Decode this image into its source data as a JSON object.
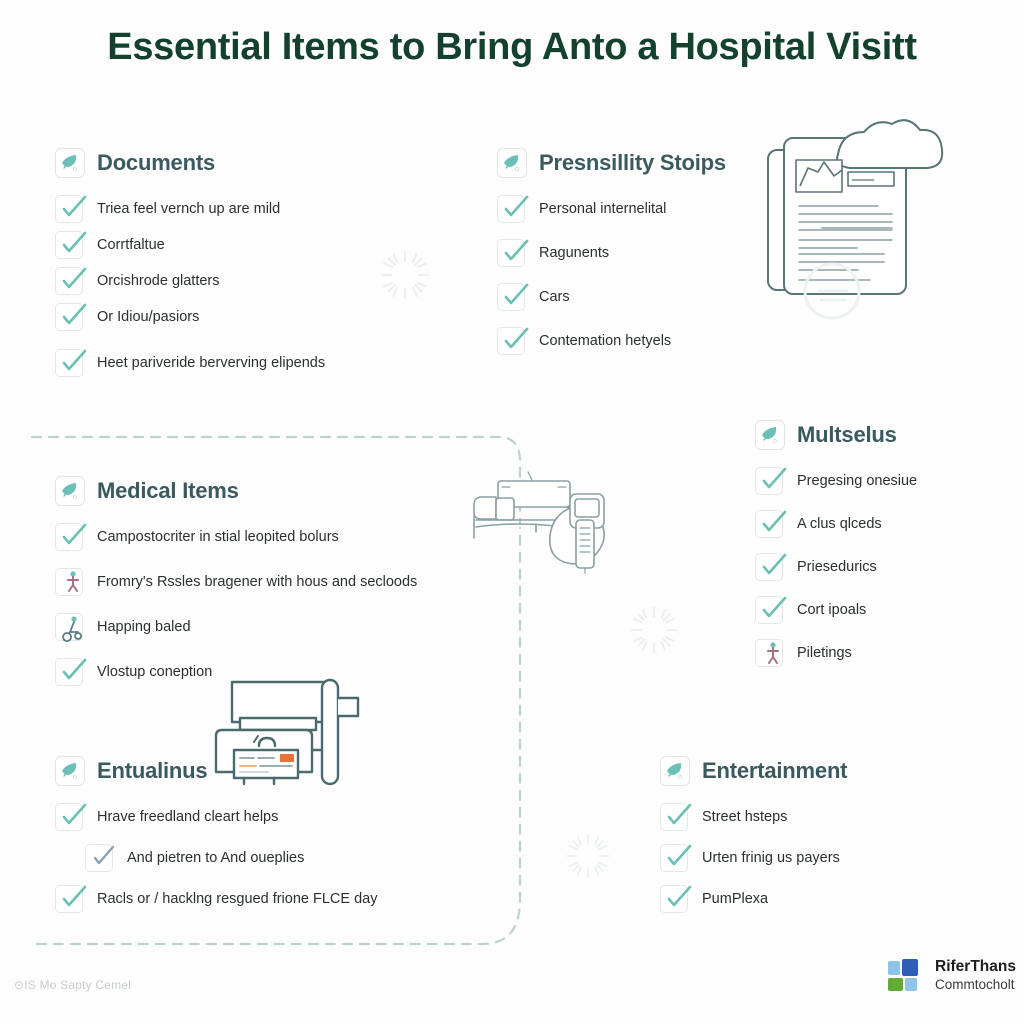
{
  "title": "Essential Items to Bring Anto a Hospital Visitt",
  "colors": {
    "title": "#14402e",
    "section_heading": "#3a5a5e",
    "body_text": "#2b2f33",
    "accent_teal": "#6bbfb5",
    "line_art": "#5a7478",
    "dashed_line": "#bcd2d2",
    "orange_accent": "#e8743b",
    "logo_blue": "#2f5fb5",
    "logo_green": "#62ab36",
    "background": "#fdfdfd"
  },
  "sections": [
    {
      "id": "documents",
      "title": "Documents",
      "icon": "leaf-check-icon",
      "items": [
        {
          "label": "Triea feel vernch up are mild",
          "icon": "checkbox-checked-icon",
          "indent": false
        },
        {
          "label": "Corrtfaltue",
          "icon": "checkbox-checked-icon",
          "indent": false
        },
        {
          "label": "Orcishrode glatters",
          "icon": "checkbox-checked-icon",
          "indent": false
        },
        {
          "label": "Or Idiou/pasiors",
          "icon": "checkbox-checked-icon",
          "indent": false
        },
        {
          "label": "Heet pariveride berverving elipends",
          "icon": "checkbox-checked-icon",
          "indent": false
        }
      ]
    },
    {
      "id": "presnsillity-stoips",
      "title": "Presnsillity Stoips",
      "icon": "leaf-check-icon",
      "items": [
        {
          "label": "Personal internelital",
          "icon": "checkbox-checked-icon",
          "indent": false
        },
        {
          "label": "Ragunents",
          "icon": "checkbox-checked-icon",
          "indent": false
        },
        {
          "label": "Cars",
          "icon": "checkbox-checked-icon",
          "indent": false
        },
        {
          "label": "Contemation hetyels",
          "icon": "checkbox-checked-icon",
          "indent": false
        }
      ]
    },
    {
      "id": "medical-items",
      "title": "Medical Items",
      "icon": "leaf-check-icon",
      "items": [
        {
          "label": "Campostocriter in stial leopited bolurs",
          "icon": "checkbox-checked-icon",
          "indent": false
        },
        {
          "label": "Fromry's Rssles bragener with hous and secloods",
          "icon": "checkbox-person-icon",
          "indent": false
        },
        {
          "label": "Happing baled",
          "icon": "checkbox-person-icon",
          "indent": false
        },
        {
          "label": "Vlostup coneption",
          "icon": "checkbox-checked-icon",
          "indent": false
        }
      ]
    },
    {
      "id": "multselus",
      "title": "Multselus",
      "icon": "leaf-check-icon",
      "items": [
        {
          "label": "Pregesing onesiue",
          "icon": "checkbox-checked-icon",
          "indent": false
        },
        {
          "label": "A clus qlceds",
          "icon": "checkbox-checked-icon",
          "indent": false
        },
        {
          "label": "Priesedurics",
          "icon": "checkbox-checked-icon",
          "indent": false
        },
        {
          "label": "Cort ipoals",
          "icon": "checkbox-checked-icon",
          "indent": false
        },
        {
          "label": "Piletings",
          "icon": "checkbox-person-icon",
          "indent": false
        }
      ]
    },
    {
      "id": "entualinus",
      "title": "Entualinus",
      "icon": "leaf-check-icon",
      "items": [
        {
          "label": "Hrave freedland cleart helps",
          "icon": "checkbox-checked-icon",
          "indent": false
        },
        {
          "label": "And pietren to And oueplies",
          "icon": "checkbox-checked-icon",
          "indent": true
        },
        {
          "label": "Racls or / hacklng resgued frione FLCE day",
          "icon": "checkbox-checked-icon",
          "indent": false
        }
      ]
    },
    {
      "id": "entertainment",
      "title": "Entertainment",
      "icon": "leaf-check-icon",
      "items": [
        {
          "label": "Street hsteps",
          "icon": "checkbox-checked-icon",
          "indent": false
        },
        {
          "label": "Urten frinig us payers",
          "icon": "checkbox-checked-icon",
          "indent": false
        },
        {
          "label": "PumPlexa",
          "icon": "checkbox-checked-icon",
          "indent": false
        }
      ]
    }
  ],
  "illustrations": [
    {
      "id": "document-cloud-illustration",
      "name": "document-cloud-illustration"
    },
    {
      "id": "hospital-bed-illustration",
      "name": "hospital-bed-illustration"
    },
    {
      "id": "medical-printer-illustration",
      "name": "medical-printer-illustration"
    }
  ],
  "footer": {
    "note": "⊙IS Mo Sapty Cemel",
    "logo_line1": "RiferThans",
    "logo_line2": "Commtocholt"
  }
}
